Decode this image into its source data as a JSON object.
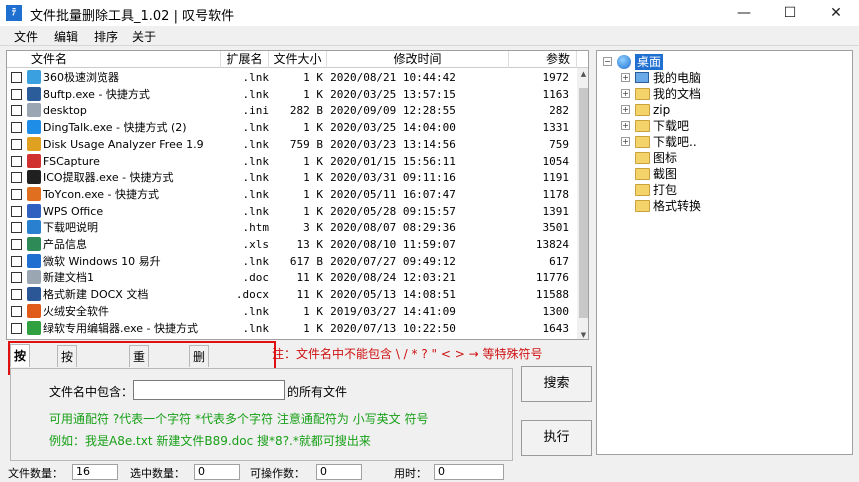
{
  "window": {
    "title": "文件批量删除工具_1.02 | 叹号软件",
    "app_icon_text": "ﾃ",
    "minimize": "—",
    "maximize": "☐",
    "close": "✕"
  },
  "menu": [
    "文件",
    "编辑",
    "排序",
    "关于"
  ],
  "file_list": {
    "columns": [
      "文件名",
      "扩展名",
      "文件大小",
      "修改时间",
      "参数"
    ],
    "rows": [
      {
        "name": "360极速浏览器",
        "ext": ".lnk",
        "size": "1 K",
        "date": "2020/08/21 10:44:42",
        "param": "1972",
        "icon": "browser-icon",
        "color": "#3aa0e0"
      },
      {
        "name": "8uftp.exe - 快捷方式",
        "ext": ".lnk",
        "size": "1 K",
        "date": "2020/03/25 13:57:15",
        "param": "1163",
        "icon": "ftp-icon",
        "color": "#2b5d9a"
      },
      {
        "name": "desktop",
        "ext": ".ini",
        "size": "282 B",
        "date": "2020/09/09 12:28:55",
        "param": "282",
        "icon": "ini-file-icon",
        "color": "#9aa6b2"
      },
      {
        "name": "DingTalk.exe - 快捷方式 (2)",
        "ext": ".lnk",
        "size": "1 K",
        "date": "2020/03/25 14:04:00",
        "param": "1331",
        "icon": "dingtalk-icon",
        "color": "#1e8de8"
      },
      {
        "name": "Disk Usage Analyzer Free 1.9",
        "ext": ".lnk",
        "size": "759 B",
        "date": "2020/03/23 13:14:56",
        "param": "759",
        "icon": "disk-icon",
        "color": "#e0a020"
      },
      {
        "name": "FSCapture",
        "ext": ".lnk",
        "size": "1 K",
        "date": "2020/01/15 15:56:11",
        "param": "1054",
        "icon": "capture-icon",
        "color": "#d03030"
      },
      {
        "name": "ICO提取器.exe - 快捷方式",
        "ext": ".lnk",
        "size": "1 K",
        "date": "2020/03/31 09:11:16",
        "param": "1191",
        "icon": "ico-extractor-icon",
        "color": "#202020"
      },
      {
        "name": "ToYcon.exe - 快捷方式",
        "ext": ".lnk",
        "size": "1 K",
        "date": "2020/05/11 16:07:47",
        "param": "1178",
        "icon": "toycon-icon",
        "color": "#e07020"
      },
      {
        "name": "WPS Office",
        "ext": ".lnk",
        "size": "1 K",
        "date": "2020/05/28 09:15:57",
        "param": "1391",
        "icon": "wps-icon",
        "color": "#3060c0"
      },
      {
        "name": "下载吧说明",
        "ext": ".htm",
        "size": "3 K",
        "date": "2020/08/07 08:29:36",
        "param": "3501",
        "icon": "ie-icon",
        "color": "#2a80d0"
      },
      {
        "name": "产品信息",
        "ext": ".xls",
        "size": "13 K",
        "date": "2020/08/10 11:59:07",
        "param": "13824",
        "icon": "spreadsheet-icon",
        "color": "#2e8b57"
      },
      {
        "name": "微软 Windows 10 易升",
        "ext": ".lnk",
        "size": "617 B",
        "date": "2020/07/27 09:49:12",
        "param": "617",
        "icon": "windows-icon",
        "color": "#1f6fd1"
      },
      {
        "name": "新建文档1",
        "ext": ".doc",
        "size": "11 K",
        "date": "2020/08/24 12:03:21",
        "param": "11776",
        "icon": "document-icon",
        "color": "#9aa6b2"
      },
      {
        "name": "格式新建 DOCX 文档",
        "ext": ".docx",
        "size": "11 K",
        "date": "2020/05/13 14:08:51",
        "param": "11588",
        "icon": "word-doc-icon",
        "color": "#2b5797"
      },
      {
        "name": "火绒安全软件",
        "ext": ".lnk",
        "size": "1 K",
        "date": "2019/03/27 14:41:09",
        "param": "1300",
        "icon": "huorong-icon",
        "color": "#e05a1a"
      },
      {
        "name": "绿软专用编辑器.exe - 快捷方式",
        "ext": ".lnk",
        "size": "1 K",
        "date": "2020/07/13 10:22:50",
        "param": "1643",
        "icon": "editor-icon",
        "color": "#30a040"
      }
    ]
  },
  "tree": {
    "root": "桌面",
    "items": [
      {
        "label": "我的电脑",
        "icon": "computer-icon",
        "expander": "+"
      },
      {
        "label": "我的文档",
        "icon": "folder-icon",
        "expander": "+"
      },
      {
        "label": "zip",
        "icon": "folder-icon",
        "expander": "+"
      },
      {
        "label": "下载吧",
        "icon": "folder-icon",
        "expander": "+"
      },
      {
        "label": "下载吧..",
        "icon": "folder-icon",
        "expander": "+"
      },
      {
        "label": "图标",
        "icon": "folder-icon",
        "expander": ""
      },
      {
        "label": "截图",
        "icon": "folder-icon",
        "expander": ""
      },
      {
        "label": "打包",
        "icon": "folder-icon",
        "expander": ""
      },
      {
        "label": "格式转换",
        "icon": "folder-icon",
        "expander": ""
      }
    ]
  },
  "tabs": [
    "按名称",
    "按大小时间",
    "重复文件",
    "删子目录"
  ],
  "warning": "注：文件名中不能包含 \\ /  * ? \" < > → 等特殊符号",
  "search_panel": {
    "label_prefix": "文件名中包含：",
    "input_value": "",
    "label_suffix": "的所有文件",
    "hint1": "可用通配符 ?代表一个字符 *代表多个字符  注意通配符为 小写英文 符号",
    "hint2": "例如：我是A8e.txt 新建文件B89.doc 搜*8?.*就都可搜出来"
  },
  "buttons": {
    "search": "搜索",
    "execute": "执行"
  },
  "status": {
    "file_count_label": "文件数量：",
    "file_count": "16",
    "selected_label": "选中数量：",
    "selected": "0",
    "operable_label": "可操作数：",
    "operable": "0",
    "elapsed_label": "用时：",
    "elapsed": "0"
  },
  "colors": {
    "warning": "#d01010",
    "hint": "#18a018",
    "highlight": "#e01010"
  }
}
